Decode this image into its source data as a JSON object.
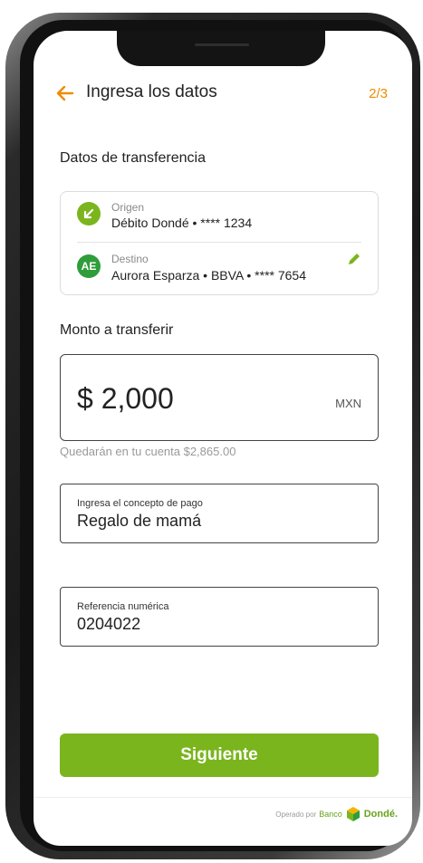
{
  "header": {
    "title": "Ingresa los datos",
    "step": "2/3",
    "back_icon": "arrow-left-icon"
  },
  "transfer": {
    "section_title": "Datos de transferencia",
    "origin": {
      "label": "Origen",
      "value": "Débito Dondé • **** 1234",
      "icon": "arrow-down-left-icon"
    },
    "destination": {
      "label": "Destino",
      "initials": "AE",
      "value": "Aurora Esparza • BBVA • **** 7654",
      "edit_icon": "pencil-icon"
    }
  },
  "amount": {
    "section_title": "Monto a transferir",
    "value": "$ 2,000",
    "currency": "MXN",
    "helper": "Quedarán en tu cuenta $2,865.00"
  },
  "concept": {
    "label": "Ingresa el concepto de pago",
    "value": "Regalo de mamá"
  },
  "reference": {
    "label": "Referencia numérica",
    "value": "0204022"
  },
  "actions": {
    "next_label": "Siguiente"
  },
  "footer": {
    "operated_by": "Operado por",
    "bank": "Banco",
    "brand": "Dondé."
  },
  "colors": {
    "accent_green": "#7ab51d",
    "accent_orange": "#f08a00",
    "avatar_green": "#2f9d3a"
  }
}
